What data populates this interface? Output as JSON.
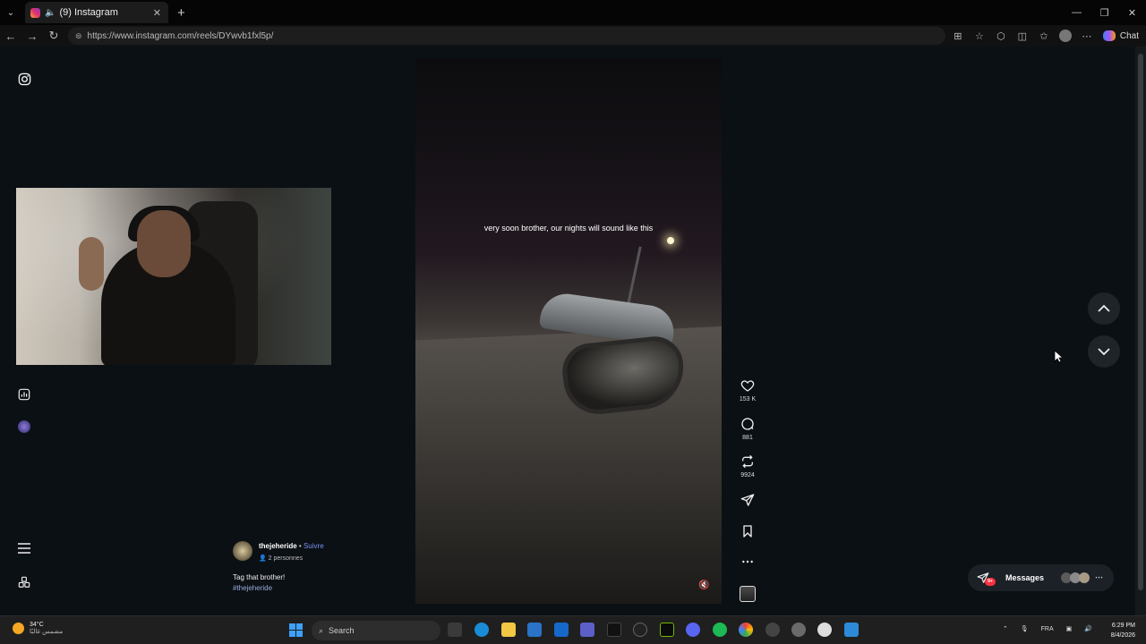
{
  "browser": {
    "tab_title": "(9) Instagram",
    "url": "https://www.instagram.com/reels/DYwvb1fxl5p/",
    "chat_label": "Chat"
  },
  "reel": {
    "overlay_text": "very soon brother, our nights will sound like this",
    "username": "thejeheride",
    "separator": "•",
    "follow_label": "Suivre",
    "collab": "2 personnes",
    "caption": "Tag that brother!",
    "hashtag": "#thejeheride",
    "likes": "153 K",
    "comments": "881",
    "reposts": "9924"
  },
  "messages": {
    "label": "Messages",
    "badge": "9+"
  },
  "taskbar": {
    "temperature": "34°C",
    "weather_desc": "مشمس غالبًا",
    "search_placeholder": "Search",
    "language": "FRA",
    "time": "6:29 PM",
    "date": "8/4/2026"
  },
  "colors": {
    "follow": "#7b8ff7",
    "badge": "#ff3040",
    "background": "#0b1014"
  }
}
